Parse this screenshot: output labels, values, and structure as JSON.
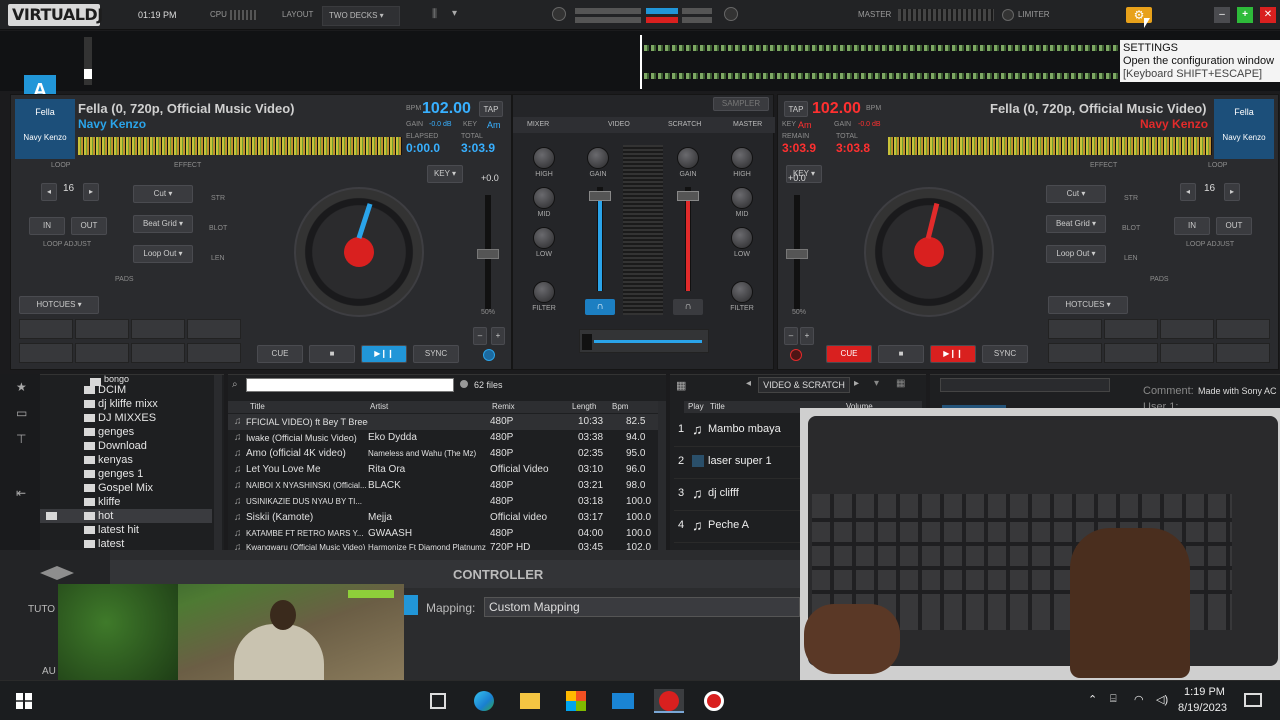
{
  "app": {
    "logo": "VIRTUALDJ",
    "clock": "01:19 PM",
    "cpu_label": "CPU",
    "layout_label": "LAYOUT",
    "layout_value": "TWO DECKS",
    "master_label": "MASTER",
    "limiter_label": "LIMITER"
  },
  "tooltip": {
    "title": "SETTINGS",
    "line1": "Open the configuration window",
    "line2": "[Keyboard SHIFT+ESCAPE]"
  },
  "deck_a": {
    "letter": "A",
    "art_top": "Fella",
    "art_bottom": "Navy Kenzo",
    "title": "Fella (0, 720p, Official Music Video)",
    "artist": "Navy Kenzo",
    "bpm": "102.00",
    "bpm_unit": "BPM",
    "tap": "TAP",
    "gain_label": "GAIN",
    "gain": "-0.0 dB",
    "key_label": "KEY",
    "key": "Am",
    "elapsed_label": "ELAPSED",
    "elapsed": "0:00.0",
    "total_label": "TOTAL",
    "total": "3:03.9",
    "loop_label": "LOOP",
    "effect_label": "EFFECT",
    "loop_size": "16",
    "in": "IN",
    "out": "OUT",
    "loop_adjust": "LOOP ADJUST",
    "fx1": "Cut",
    "fx2": "Beat Grid",
    "fx3": "Loop Out",
    "str": "STR",
    "blot": "BLOT",
    "len": "LEN",
    "key_btn": "KEY",
    "pitch": "+0.0",
    "pads_label": "PADS",
    "hotcues": "HOTCUES",
    "cue": "CUE",
    "stop": "■",
    "play": "▶❙❙",
    "sync": "SYNC",
    "pitch_range": "50%"
  },
  "deck_b": {
    "art_top": "Fella",
    "art_bottom": "Navy Kenzo",
    "title": "Fella (0, 720p, Official Music Video)",
    "artist": "Navy Kenzo",
    "bpm": "102.00",
    "bpm_unit": "BPM",
    "tap": "TAP",
    "gain_label": "GAIN",
    "gain": "-0.0 dB",
    "key_label": "KEY",
    "key": "Am",
    "remain_label": "REMAIN",
    "remain": "3:03.9",
    "total_label": "TOTAL",
    "total": "3:03.8",
    "loop_label": "LOOP",
    "effect_label": "EFFECT",
    "loop_size": "16",
    "in": "IN",
    "out": "OUT",
    "loop_adjust": "LOOP ADJUST",
    "fx1": "Cut",
    "fx2": "Beat Grid",
    "fx3": "Loop Out",
    "str": "STR",
    "blot": "BLOT",
    "len": "LEN",
    "key_btn": "KEY",
    "pitch": "+0.0",
    "pads_label": "PADS",
    "hotcues": "HOTCUES",
    "cue": "CUE",
    "stop": "■",
    "play": "▶❙❙",
    "sync": "SYNC",
    "pitch_range": "50%"
  },
  "mixer": {
    "tab_mixer": "MIXER",
    "tab_video": "VIDEO",
    "tab_scratch": "SCRATCH",
    "tab_master": "MASTER",
    "sampler": "SAMPLER",
    "high": "HIGH",
    "mid": "MID",
    "low": "LOW",
    "filter": "FILTER",
    "gain": "GAIN"
  },
  "browser": {
    "folders": [
      "bongo",
      "DCIM",
      "dj kliffe mixx",
      "DJ MIXXES",
      "genges",
      "Download",
      "kenyas",
      "genges 1",
      "Gospel Mix",
      "kliffe",
      "hot",
      "latest hit",
      "latest"
    ],
    "file_count": "62 files",
    "columns": [
      "Title",
      "Artist",
      "Remix",
      "Length",
      "Bpm"
    ],
    "rows": [
      [
        "FFICIAL VIDEO) ft Bey T  Breeder",
        "",
        "480P",
        "10:33",
        "82.5"
      ],
      [
        "Iwake (Official Music Video)",
        "Eko Dydda",
        "480P",
        "03:38",
        "94.0"
      ],
      [
        "Amo  (official 4K video)",
        "Nameless and Wahu  (The Mz)",
        "480P",
        "02:35",
        "95.0"
      ],
      [
        "Let You Love Me",
        "Rita Ora",
        "Official Video",
        "03:10",
        "96.0"
      ],
      [
        "NAIBOI X NYASHINSKI (Official...",
        "BLACK",
        "480P",
        "03:21",
        "98.0"
      ],
      [
        "USINIKAZIE  DUS NYAU  BY TI...",
        "",
        "480P",
        "03:18",
        "100.0"
      ],
      [
        "Siskii (Kamote)",
        "Mejja",
        "Official video",
        "03:17",
        "100.0"
      ],
      [
        "KATAMBE FT RETRO MARS Y...",
        "GWAASH",
        "480P",
        "04:00",
        "100.0"
      ],
      [
        "Kwangwaru (Official Music Video)",
        "Harmonize Ft Diamond Platnumz",
        "720P HD",
        "03:45",
        "102.0"
      ]
    ],
    "sidelist_label": "VIDEO & SCRATCH",
    "side_cols": [
      "Play",
      "Title",
      "Volume"
    ],
    "side_rows": [
      [
        "1",
        "Mambo mbaya"
      ],
      [
        "2",
        "laser super 1"
      ],
      [
        "3",
        "dj clifff"
      ],
      [
        "4",
        "Peche A"
      ]
    ],
    "comment_label": "Comment:",
    "comment": "Made with Sony AC",
    "user_label": "User 1:"
  },
  "controller": {
    "title": "CONTROLLER",
    "mapping_label": "Mapping:",
    "mapping_value": "Custom Mapping",
    "side_a": "TUTO",
    "side_b": "AU"
  },
  "taskbar": {
    "time": "1:19 PM",
    "date": "8/19/2023"
  }
}
